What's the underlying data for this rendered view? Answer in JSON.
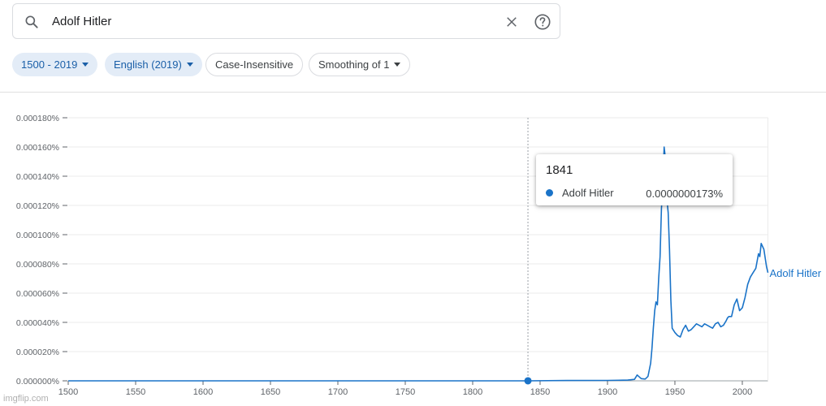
{
  "search": {
    "query": "Adolf Hitler"
  },
  "filters": {
    "year_range": "1500 - 2019",
    "corpus": "English (2019)",
    "case": "Case-Insensitive",
    "smoothing": "Smoothing of 1"
  },
  "tooltip": {
    "year": "1841",
    "series_name": "Adolf Hitler",
    "value": "0.0000000173%"
  },
  "watermark": "imgflip.com",
  "colors": {
    "accent": "#1a73c8",
    "chip_active_bg": "#e3ecf7",
    "chip_active_text": "#1a5fa8"
  },
  "chart_data": {
    "type": "line",
    "xlim": [
      1500,
      2019
    ],
    "ylim": [
      0,
      0.00018
    ],
    "x_ticks": [
      "1500",
      "1550",
      "1600",
      "1650",
      "1700",
      "1750",
      "1800",
      "1850",
      "1900",
      "1950",
      "2000"
    ],
    "y_ticks": [
      "0.000000%",
      "0.000020%",
      "0.000040%",
      "0.000060%",
      "0.000080%",
      "0.000100%",
      "0.000120%",
      "0.000140%",
      "0.000160%",
      "0.000180%"
    ],
    "series": [
      {
        "name": "Adolf Hitler",
        "x": [
          1500,
          1600,
          1700,
          1800,
          1841,
          1870,
          1900,
          1915,
          1920,
          1922,
          1925,
          1928,
          1930,
          1932,
          1933,
          1934,
          1935,
          1936,
          1937,
          1938,
          1939,
          1940,
          1941,
          1942,
          1943,
          1944,
          1945,
          1946,
          1947,
          1948,
          1950,
          1952,
          1954,
          1956,
          1958,
          1960,
          1962,
          1964,
          1966,
          1968,
          1970,
          1972,
          1974,
          1976,
          1978,
          1980,
          1982,
          1984,
          1986,
          1988,
          1989,
          1990,
          1992,
          1994,
          1996,
          1998,
          2000,
          2002,
          2004,
          2006,
          2008,
          2010,
          2012,
          2013,
          2014,
          2016,
          2018,
          2019
        ],
        "y": [
          0,
          0,
          0,
          0,
          1.73e-08,
          2e-07,
          3e-07,
          5e-07,
          1e-06,
          4e-06,
          1.5e-06,
          1.2e-06,
          3e-06,
          1.2e-05,
          2.2e-05,
          3.6e-05,
          4.8e-05,
          5.4e-05,
          5.2e-05,
          7e-05,
          8.5e-05,
          0.000118,
          0.000131,
          0.00016,
          0.000152,
          0.000125,
          0.000115,
          9e-05,
          5.5e-05,
          3.6e-05,
          3.3e-05,
          3.1e-05,
          3e-05,
          3.5e-05,
          3.8e-05,
          3.4e-05,
          3.5e-05,
          3.7e-05,
          3.9e-05,
          3.8e-05,
          3.7e-05,
          3.9e-05,
          3.8e-05,
          3.7e-05,
          3.6e-05,
          3.9e-05,
          4e-05,
          3.7e-05,
          3.8e-05,
          4.1e-05,
          4.3e-05,
          4.4e-05,
          4.4e-05,
          5.2e-05,
          5.6e-05,
          4.8e-05,
          5e-05,
          5.7e-05,
          6.6e-05,
          7.1e-05,
          7.4e-05,
          7.7e-05,
          8.7e-05,
          8.5e-05,
          9.4e-05,
          9e-05,
          7.8e-05,
          7.4e-05
        ]
      }
    ],
    "highlight": {
      "x": 1841,
      "y": 1.73e-08
    },
    "line_label": "Adolf Hitler"
  }
}
